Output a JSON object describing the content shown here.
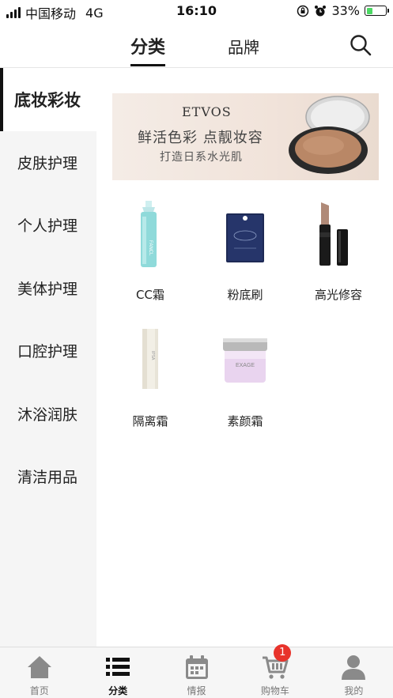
{
  "status_bar": {
    "carrier": "中国移动",
    "network": "4G",
    "time": "16:10",
    "battery": "33%",
    "battery_level": 0.33
  },
  "top_tabs": [
    {
      "label": "分类",
      "active": true
    },
    {
      "label": "品牌",
      "active": false
    }
  ],
  "search": {
    "icon": "search-icon"
  },
  "sidebar": {
    "items": [
      {
        "label": "底妆彩妆",
        "active": true
      },
      {
        "label": "皮肤护理",
        "active": false
      },
      {
        "label": "个人护理",
        "active": false
      },
      {
        "label": "美体护理",
        "active": false
      },
      {
        "label": "口腔护理",
        "active": false
      },
      {
        "label": "沐浴润肤",
        "active": false
      },
      {
        "label": "清洁用品",
        "active": false
      }
    ]
  },
  "banner": {
    "brand": "ETVOS",
    "line1": "鲜活色彩 点靓妆容",
    "line2": "打造日系水光肌"
  },
  "products": [
    {
      "label": "CC霜",
      "icon": "cc-cream-bottle"
    },
    {
      "label": "粉底刷",
      "icon": "foundation-brush-pack"
    },
    {
      "label": "高光修容",
      "icon": "highlighter-stick"
    },
    {
      "label": "隔离霜",
      "icon": "primer-tube"
    },
    {
      "label": "素颜霜",
      "icon": "cream-jar"
    }
  ],
  "tab_bar": {
    "items": [
      {
        "label": "首页",
        "icon": "home-icon",
        "active": false
      },
      {
        "label": "分类",
        "icon": "list-icon",
        "active": true
      },
      {
        "label": "情报",
        "icon": "calendar-icon",
        "active": false
      },
      {
        "label": "购物车",
        "icon": "cart-icon",
        "active": false,
        "badge": "1"
      },
      {
        "label": "我的",
        "icon": "user-icon",
        "active": false
      }
    ]
  },
  "colors": {
    "accent": "#111111",
    "badge": "#e8332b",
    "sidebar_bg": "#f5f5f5"
  }
}
